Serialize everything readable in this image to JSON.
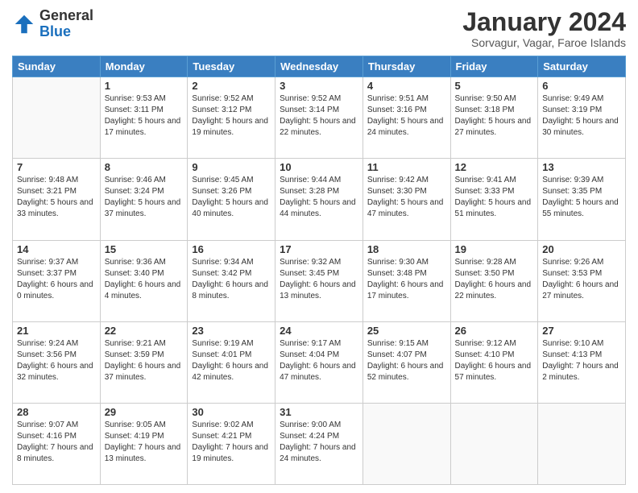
{
  "header": {
    "logo_general": "General",
    "logo_blue": "Blue",
    "month_title": "January 2024",
    "subtitle": "Sorvagur, Vagar, Faroe Islands"
  },
  "weekdays": [
    "Sunday",
    "Monday",
    "Tuesday",
    "Wednesday",
    "Thursday",
    "Friday",
    "Saturday"
  ],
  "weeks": [
    [
      {
        "day": "",
        "sunrise": "",
        "sunset": "",
        "daylight": ""
      },
      {
        "day": "1",
        "sunrise": "Sunrise: 9:53 AM",
        "sunset": "Sunset: 3:11 PM",
        "daylight": "Daylight: 5 hours and 17 minutes."
      },
      {
        "day": "2",
        "sunrise": "Sunrise: 9:52 AM",
        "sunset": "Sunset: 3:12 PM",
        "daylight": "Daylight: 5 hours and 19 minutes."
      },
      {
        "day": "3",
        "sunrise": "Sunrise: 9:52 AM",
        "sunset": "Sunset: 3:14 PM",
        "daylight": "Daylight: 5 hours and 22 minutes."
      },
      {
        "day": "4",
        "sunrise": "Sunrise: 9:51 AM",
        "sunset": "Sunset: 3:16 PM",
        "daylight": "Daylight: 5 hours and 24 minutes."
      },
      {
        "day": "5",
        "sunrise": "Sunrise: 9:50 AM",
        "sunset": "Sunset: 3:18 PM",
        "daylight": "Daylight: 5 hours and 27 minutes."
      },
      {
        "day": "6",
        "sunrise": "Sunrise: 9:49 AM",
        "sunset": "Sunset: 3:19 PM",
        "daylight": "Daylight: 5 hours and 30 minutes."
      }
    ],
    [
      {
        "day": "7",
        "sunrise": "Sunrise: 9:48 AM",
        "sunset": "Sunset: 3:21 PM",
        "daylight": "Daylight: 5 hours and 33 minutes."
      },
      {
        "day": "8",
        "sunrise": "Sunrise: 9:46 AM",
        "sunset": "Sunset: 3:24 PM",
        "daylight": "Daylight: 5 hours and 37 minutes."
      },
      {
        "day": "9",
        "sunrise": "Sunrise: 9:45 AM",
        "sunset": "Sunset: 3:26 PM",
        "daylight": "Daylight: 5 hours and 40 minutes."
      },
      {
        "day": "10",
        "sunrise": "Sunrise: 9:44 AM",
        "sunset": "Sunset: 3:28 PM",
        "daylight": "Daylight: 5 hours and 44 minutes."
      },
      {
        "day": "11",
        "sunrise": "Sunrise: 9:42 AM",
        "sunset": "Sunset: 3:30 PM",
        "daylight": "Daylight: 5 hours and 47 minutes."
      },
      {
        "day": "12",
        "sunrise": "Sunrise: 9:41 AM",
        "sunset": "Sunset: 3:33 PM",
        "daylight": "Daylight: 5 hours and 51 minutes."
      },
      {
        "day": "13",
        "sunrise": "Sunrise: 9:39 AM",
        "sunset": "Sunset: 3:35 PM",
        "daylight": "Daylight: 5 hours and 55 minutes."
      }
    ],
    [
      {
        "day": "14",
        "sunrise": "Sunrise: 9:37 AM",
        "sunset": "Sunset: 3:37 PM",
        "daylight": "Daylight: 6 hours and 0 minutes."
      },
      {
        "day": "15",
        "sunrise": "Sunrise: 9:36 AM",
        "sunset": "Sunset: 3:40 PM",
        "daylight": "Daylight: 6 hours and 4 minutes."
      },
      {
        "day": "16",
        "sunrise": "Sunrise: 9:34 AM",
        "sunset": "Sunset: 3:42 PM",
        "daylight": "Daylight: 6 hours and 8 minutes."
      },
      {
        "day": "17",
        "sunrise": "Sunrise: 9:32 AM",
        "sunset": "Sunset: 3:45 PM",
        "daylight": "Daylight: 6 hours and 13 minutes."
      },
      {
        "day": "18",
        "sunrise": "Sunrise: 9:30 AM",
        "sunset": "Sunset: 3:48 PM",
        "daylight": "Daylight: 6 hours and 17 minutes."
      },
      {
        "day": "19",
        "sunrise": "Sunrise: 9:28 AM",
        "sunset": "Sunset: 3:50 PM",
        "daylight": "Daylight: 6 hours and 22 minutes."
      },
      {
        "day": "20",
        "sunrise": "Sunrise: 9:26 AM",
        "sunset": "Sunset: 3:53 PM",
        "daylight": "Daylight: 6 hours and 27 minutes."
      }
    ],
    [
      {
        "day": "21",
        "sunrise": "Sunrise: 9:24 AM",
        "sunset": "Sunset: 3:56 PM",
        "daylight": "Daylight: 6 hours and 32 minutes."
      },
      {
        "day": "22",
        "sunrise": "Sunrise: 9:21 AM",
        "sunset": "Sunset: 3:59 PM",
        "daylight": "Daylight: 6 hours and 37 minutes."
      },
      {
        "day": "23",
        "sunrise": "Sunrise: 9:19 AM",
        "sunset": "Sunset: 4:01 PM",
        "daylight": "Daylight: 6 hours and 42 minutes."
      },
      {
        "day": "24",
        "sunrise": "Sunrise: 9:17 AM",
        "sunset": "Sunset: 4:04 PM",
        "daylight": "Daylight: 6 hours and 47 minutes."
      },
      {
        "day": "25",
        "sunrise": "Sunrise: 9:15 AM",
        "sunset": "Sunset: 4:07 PM",
        "daylight": "Daylight: 6 hours and 52 minutes."
      },
      {
        "day": "26",
        "sunrise": "Sunrise: 9:12 AM",
        "sunset": "Sunset: 4:10 PM",
        "daylight": "Daylight: 6 hours and 57 minutes."
      },
      {
        "day": "27",
        "sunrise": "Sunrise: 9:10 AM",
        "sunset": "Sunset: 4:13 PM",
        "daylight": "Daylight: 7 hours and 2 minutes."
      }
    ],
    [
      {
        "day": "28",
        "sunrise": "Sunrise: 9:07 AM",
        "sunset": "Sunset: 4:16 PM",
        "daylight": "Daylight: 7 hours and 8 minutes."
      },
      {
        "day": "29",
        "sunrise": "Sunrise: 9:05 AM",
        "sunset": "Sunset: 4:19 PM",
        "daylight": "Daylight: 7 hours and 13 minutes."
      },
      {
        "day": "30",
        "sunrise": "Sunrise: 9:02 AM",
        "sunset": "Sunset: 4:21 PM",
        "daylight": "Daylight: 7 hours and 19 minutes."
      },
      {
        "day": "31",
        "sunrise": "Sunrise: 9:00 AM",
        "sunset": "Sunset: 4:24 PM",
        "daylight": "Daylight: 7 hours and 24 minutes."
      },
      {
        "day": "",
        "sunrise": "",
        "sunset": "",
        "daylight": ""
      },
      {
        "day": "",
        "sunrise": "",
        "sunset": "",
        "daylight": ""
      },
      {
        "day": "",
        "sunrise": "",
        "sunset": "",
        "daylight": ""
      }
    ]
  ]
}
